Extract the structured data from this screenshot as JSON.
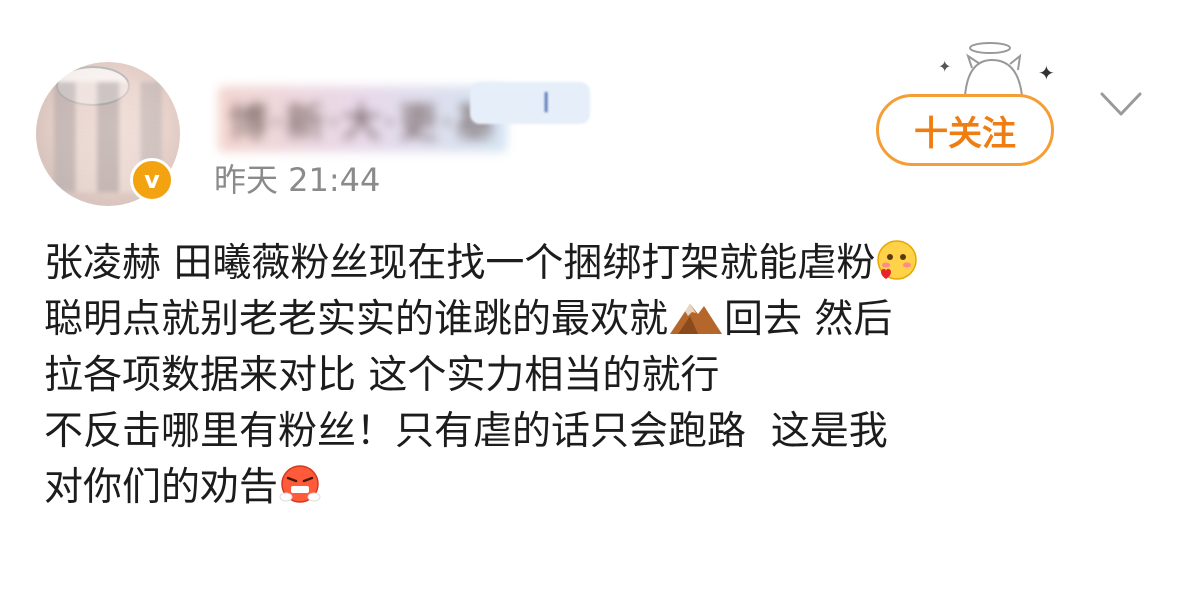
{
  "post": {
    "author": {
      "name": "博·新·大·更·基",
      "name_tag": "I",
      "badge": "v"
    },
    "time": "昨天 21:44",
    "follow_label": "十关注",
    "lines": [
      {
        "text": "张凌赫 田曦薇粉丝现在找一个捆绑打架就能虐粉",
        "emoji_after": "blush-heart-emoji"
      },
      {
        "text_before": "聪明点就别老老实实的谁跳的最欢就",
        "emoji_mid": "mountain-emoji",
        "text_after": "回去 然后"
      },
      {
        "text": "拉各项数据来对比 这个实力相当的就行"
      },
      {
        "text": "不反击哪里有粉丝！只有虐的话只会跑路  这是我"
      },
      {
        "text": "对你们的劝告",
        "emoji_after": "angry-steam-emoji"
      }
    ]
  },
  "icons": {
    "chevron": "chevron-down-icon",
    "decoration": "angel-cat-icon"
  },
  "colors": {
    "follow_accent": "#f07d12",
    "badge": "#f2a30f",
    "time": "#8a8a8a"
  }
}
